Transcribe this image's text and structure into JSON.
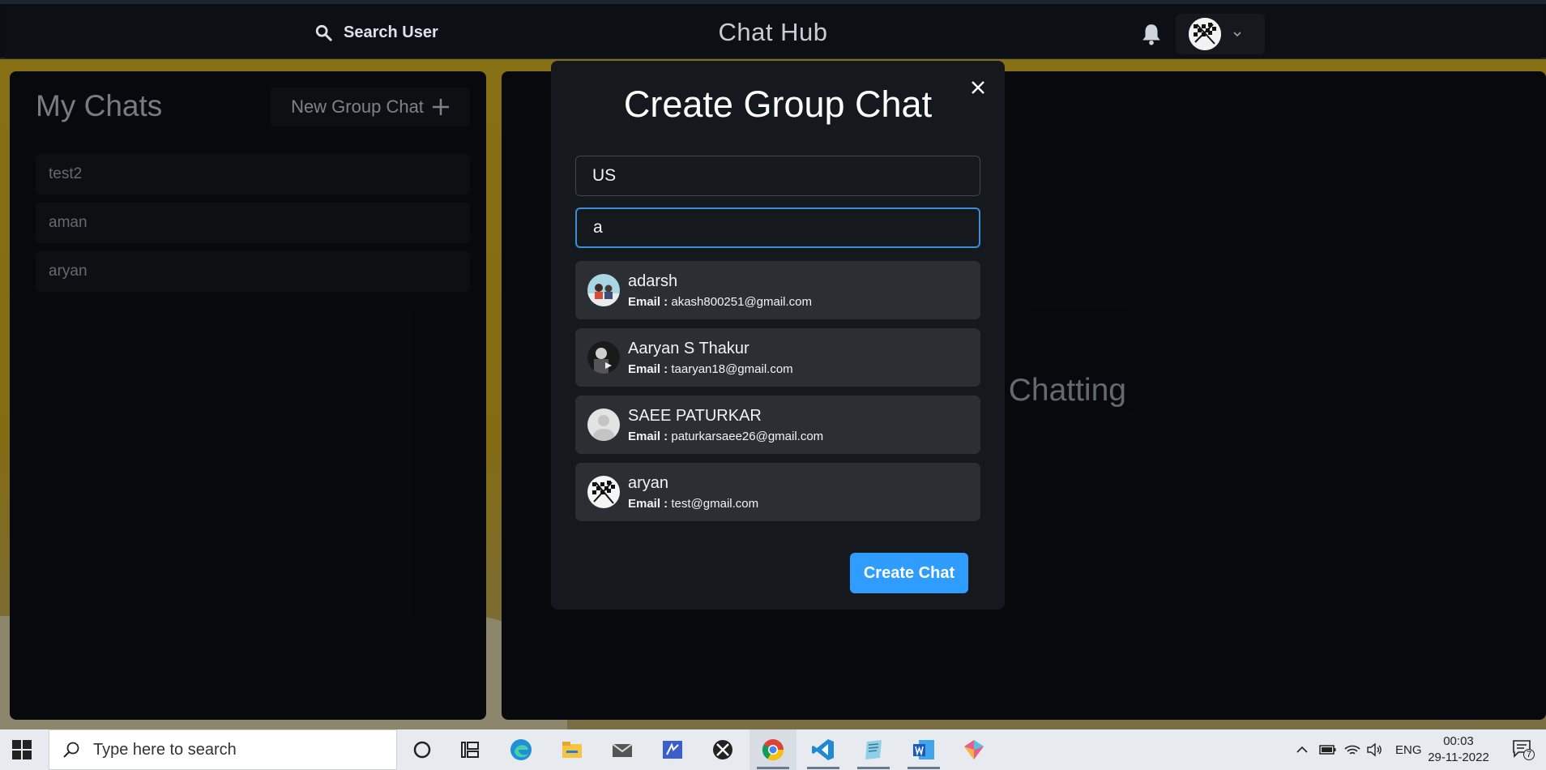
{
  "header": {
    "search_label": "Search User",
    "title": "Chat Hub"
  },
  "sidebar": {
    "title": "My Chats",
    "new_group_label": "New Group Chat",
    "chats": [
      {
        "name": "test2"
      },
      {
        "name": "aman"
      },
      {
        "name": "aryan"
      }
    ]
  },
  "chatbox": {
    "placeholder_text": "o Start Chatting"
  },
  "modal": {
    "title": "Create Group Chat",
    "chat_name_value": "US",
    "search_value": "a",
    "email_label": "Email :",
    "results": [
      {
        "name": "adarsh",
        "email": "akash800251@gmail.com",
        "avatar": "photo-avatar"
      },
      {
        "name": "Aaryan S Thakur",
        "email": "taaryan18@gmail.com",
        "avatar": "photo-avatar"
      },
      {
        "name": "SAEE PATURKAR",
        "email": "paturkarsaee26@gmail.com",
        "avatar": "default-avatar"
      },
      {
        "name": "aryan",
        "email": "test@gmail.com",
        "avatar": "checkered-flag-avatar"
      }
    ],
    "create_label": "Create Chat"
  },
  "taskbar": {
    "search_placeholder": "Type here to search",
    "language": "ENG",
    "time": "00:03",
    "date": "29-11-2022",
    "notification_count": "7",
    "apps": [
      "cortana-icon",
      "task-view-icon",
      "edge-icon",
      "file-explorer-icon",
      "mail-icon",
      "visual-app-icon",
      "xbox-icon",
      "chrome-icon",
      "vscode-icon",
      "notepad-icon",
      "word-icon",
      "app-icon"
    ]
  },
  "colors": {
    "accent": "#2f9cff",
    "panel": "#0c0f13",
    "modal": "#15191e",
    "item": "#2b2f34"
  }
}
